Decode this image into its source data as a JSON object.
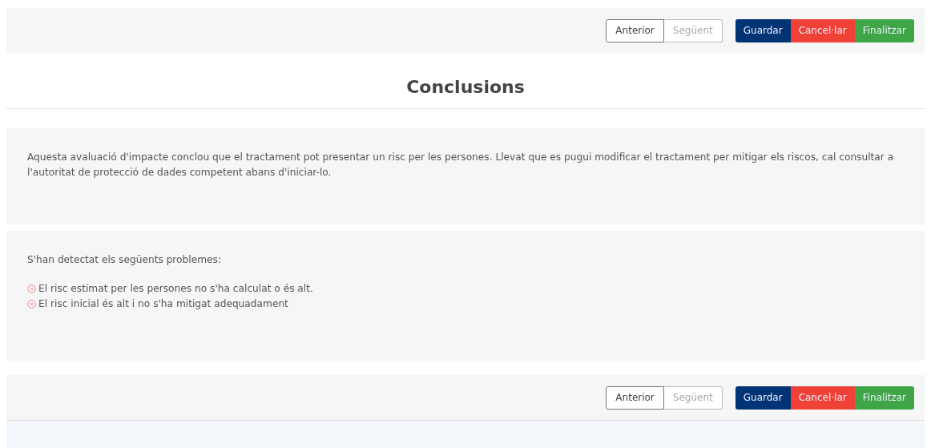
{
  "toolbars": [
    {
      "nav": [
        {
          "label": "Anterior",
          "disabled": false
        },
        {
          "label": "Següent",
          "disabled": true
        }
      ],
      "actions": [
        {
          "label": "Guardar",
          "kind": "primary"
        },
        {
          "label": "Cancel·lar",
          "kind": "danger"
        },
        {
          "label": "Finalitzar",
          "kind": "success"
        }
      ]
    },
    {
      "nav": [
        {
          "label": "Anterior",
          "disabled": false
        },
        {
          "label": "Següent",
          "disabled": true
        }
      ],
      "actions": [
        {
          "label": "Guardar",
          "kind": "primary"
        },
        {
          "label": "Cancel·lar",
          "kind": "danger"
        },
        {
          "label": "Finalitzar",
          "kind": "success"
        }
      ]
    }
  ],
  "title": "Conclusions",
  "conclusion": "Aquesta avaluació d'impacte conclou que el tractament pot presentar un risc per les persones. Llevat que es pugui modificar el tractament per mitigar els riscos, cal consultar a l'autoritat de protecció de dades competent abans d'iniciar-lo.",
  "problems": {
    "heading": "S'han detectat els següents problemes:",
    "items": [
      "El risc estimat per les persones no s'ha calculat o és alt.",
      "El risc inicial és alt i no s'ha mitigat adequadament"
    ]
  }
}
